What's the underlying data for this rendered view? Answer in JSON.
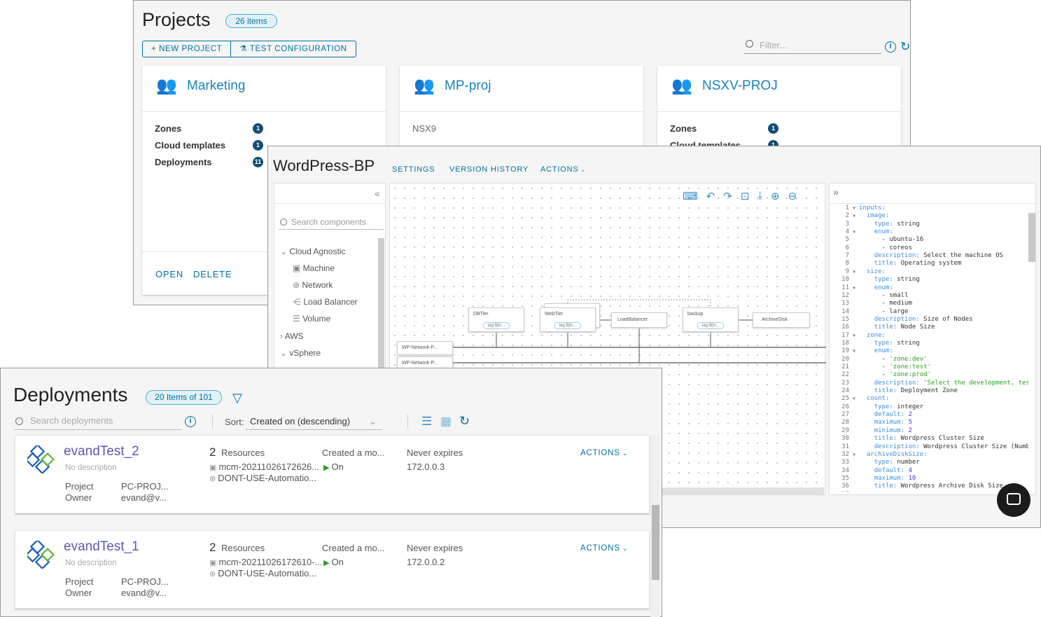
{
  "projects": {
    "title": "Projects",
    "count_badge": "26 items",
    "new_project": "+ NEW PROJECT",
    "test_configuration": "TEST CONFIGURATION",
    "filter_placeholder": "Filter...",
    "cards": [
      {
        "name": "Marketing",
        "rows": [
          {
            "label": "Zones",
            "count": "1"
          },
          {
            "label": "Cloud templates",
            "count": "1"
          },
          {
            "label": "Deployments",
            "count": "11"
          }
        ],
        "open": "OPEN",
        "delete": "DELETE"
      },
      {
        "name": "MP-proj",
        "subtitle": "NSX9"
      },
      {
        "name": "NSXV-PROJ",
        "rows": [
          {
            "label": "Zones",
            "count": "1"
          },
          {
            "label": "Cloud templates",
            "count": "1"
          }
        ]
      }
    ]
  },
  "blueprint": {
    "title": "WordPress-BP",
    "tabs": [
      "SETTINGS",
      "VERSION HISTORY",
      "ACTIONS"
    ],
    "search_placeholder": "Search components",
    "tree": [
      {
        "label": "Cloud Agnostic",
        "expanded": true,
        "children": [
          "Machine",
          "Network",
          "Load Balancer",
          "Volume"
        ]
      },
      {
        "label": "AWS",
        "expanded": false
      },
      {
        "label": "vSphere",
        "expanded": true
      }
    ],
    "nodes": {
      "dbtier": "DBTier",
      "webtier": "WebTier",
      "loadbalancer": "LoadBalancer",
      "backup": "backup",
      "archivedisk": "ArchiveDisk",
      "tag": "tag:${in...",
      "net1": "WP-Network-P...",
      "net2": "WP-Network-P..."
    },
    "code": [
      {
        "i": 0,
        "k": "inputs",
        "f": 1
      },
      {
        "i": 1,
        "k": "image",
        "f": 1
      },
      {
        "i": 2,
        "k": "type",
        "v": "string"
      },
      {
        "i": 2,
        "k": "enum",
        "f": 1
      },
      {
        "i": 3,
        "d": "ubuntu-16"
      },
      {
        "i": 3,
        "d": "coreos"
      },
      {
        "i": 2,
        "k": "description",
        "v": "Select the machine OS"
      },
      {
        "i": 2,
        "k": "title",
        "v": "Operating system"
      },
      {
        "i": 1,
        "k": "size",
        "f": 1
      },
      {
        "i": 2,
        "k": "type",
        "v": "string"
      },
      {
        "i": 2,
        "k": "enum",
        "f": 1
      },
      {
        "i": 3,
        "d": "small"
      },
      {
        "i": 3,
        "d": "medium"
      },
      {
        "i": 3,
        "d": "large"
      },
      {
        "i": 2,
        "k": "description",
        "v": "Size of Nodes"
      },
      {
        "i": 2,
        "k": "title",
        "v": "Node Size"
      },
      {
        "i": 1,
        "k": "zone",
        "f": 1
      },
      {
        "i": 2,
        "k": "type",
        "v": "string"
      },
      {
        "i": 2,
        "k": "enum",
        "f": 1
      },
      {
        "i": 3,
        "d": "'zone:dev'",
        "t": "s"
      },
      {
        "i": 3,
        "d": "'zone:test'",
        "t": "s"
      },
      {
        "i": 3,
        "d": "'zone:prod'",
        "t": "s"
      },
      {
        "i": 2,
        "k": "description",
        "v": "'Select the development, tes",
        "t": "s"
      },
      {
        "i": 2,
        "k": "title",
        "v": "Deployment Zone"
      },
      {
        "i": 1,
        "k": "count",
        "f": 1
      },
      {
        "i": 2,
        "k": "type",
        "v": "integer"
      },
      {
        "i": 2,
        "k": "default",
        "v": "2",
        "t": "nm"
      },
      {
        "i": 2,
        "k": "maximum",
        "v": "5",
        "t": "nm"
      },
      {
        "i": 2,
        "k": "minimum",
        "v": "2",
        "t": "nm"
      },
      {
        "i": 2,
        "k": "title",
        "v": "Wordpress Cluster Size"
      },
      {
        "i": 2,
        "k": "description",
        "v": "Wordpress Cluster Size (Numb"
      },
      {
        "i": 1,
        "k": "archiveDiskSize",
        "f": 1
      },
      {
        "i": 2,
        "k": "type",
        "v": "number"
      },
      {
        "i": 2,
        "k": "default",
        "v": "4",
        "t": "nm"
      },
      {
        "i": 2,
        "k": "maximum",
        "v": "10",
        "t": "nm"
      },
      {
        "i": 2,
        "k": "title",
        "v": "Wordpress Archive Disk Size"
      },
      {
        "i": 0,
        "k": ""
      }
    ]
  },
  "deployments": {
    "title": "Deployments",
    "count_badge": "20 Items of 101",
    "search_placeholder": "Search deployments",
    "sort_label": "Sort:",
    "sort_value": "Created on (descending)",
    "items": [
      {
        "name": "evandTest_2",
        "description": "No description",
        "project_label": "Project",
        "project": "PC-PROJ...",
        "owner_label": "Owner",
        "owner": "evand@v...",
        "resources_count": "2",
        "resources_label": "Resources",
        "resource1": "mcm-20211026172626...",
        "resource2": "DONT-USE-Automatio...",
        "created": "Created a mo...",
        "power": "On",
        "expires": "Never expires",
        "ip": "172.0.0.3",
        "actions": "ACTIONS"
      },
      {
        "name": "evandTest_1",
        "description": "No description",
        "project_label": "Project",
        "project": "PC-PROJ...",
        "owner_label": "Owner",
        "owner": "evand@v...",
        "resources_count": "2",
        "resources_label": "Resources",
        "resource1": "mcm-20211026172610-...",
        "resource2": "DONT-USE-Automatio...",
        "created": "Created a mo...",
        "power": "On",
        "expires": "Never expires",
        "ip": "172.0.0.2",
        "actions": "ACTIONS"
      }
    ]
  },
  "colors": {
    "accent": "#0072a3",
    "badge_dot": "#0f4f73",
    "power_on": "#2e9b2e",
    "logo_blue": "#1a5fb4",
    "logo_green": "#62b53a"
  }
}
